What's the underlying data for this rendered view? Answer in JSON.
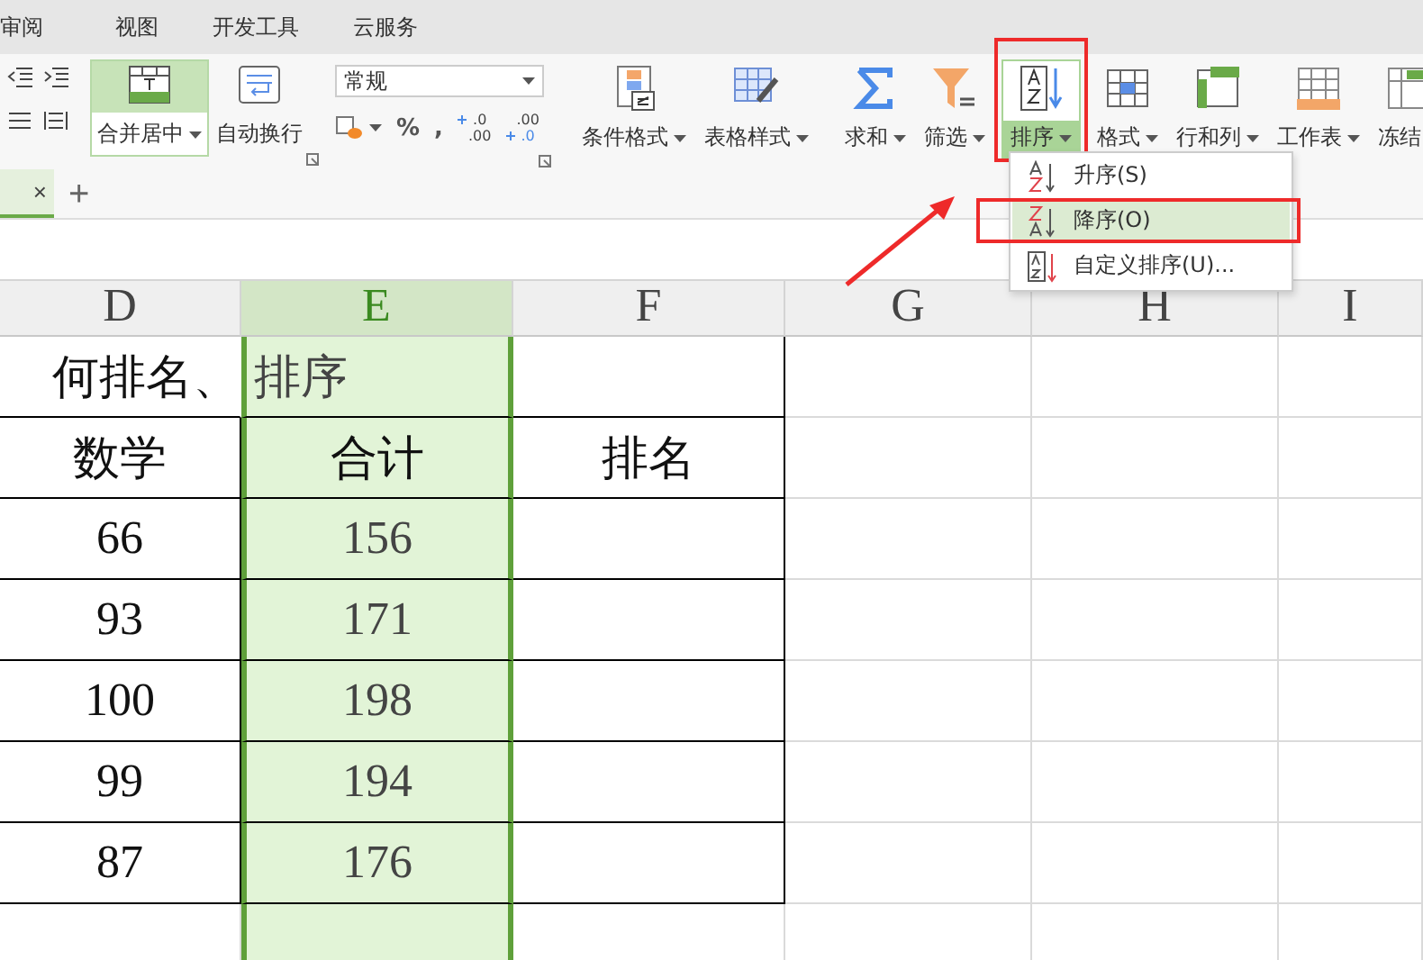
{
  "menu_tabs": [
    {
      "label": "审阅"
    },
    {
      "label": "视图"
    },
    {
      "label": "开发工具"
    },
    {
      "label": "云服务"
    }
  ],
  "merge_button": {
    "label": "合并居中",
    "selected": true
  },
  "wrap_button": {
    "label": "自动换行"
  },
  "number_format": {
    "value": "常规"
  },
  "number_buttons": [
    {
      "kind": "currency"
    },
    {
      "kind": "text",
      "label": "%"
    },
    {
      "kind": "text",
      "label": ","
    },
    {
      "kind": "decimal",
      "top": ".0",
      "bottom": ".00",
      "increase": true
    },
    {
      "kind": "decimal",
      "top": ".00",
      "bottom": ".0",
      "increase": false
    }
  ],
  "tools": [
    {
      "kind": "conditional",
      "label": "条件格式",
      "selected": false
    },
    {
      "kind": "table-style",
      "label": "表格样式",
      "selected": false
    },
    {
      "kind": "sum",
      "label": "求和",
      "selected": false
    },
    {
      "kind": "filter",
      "label": "筛选",
      "selected": false
    },
    {
      "kind": "sort",
      "label": "排序",
      "selected": true
    },
    {
      "kind": "format",
      "label": "格式",
      "selected": false
    },
    {
      "kind": "rowcol",
      "label": "行和列",
      "selected": false
    },
    {
      "kind": "sheet",
      "label": "工作表",
      "selected": false
    },
    {
      "kind": "freeze",
      "label": "冻结",
      "selected": false
    }
  ],
  "sort_menu": {
    "items": [
      {
        "kind": "asc",
        "label": "升序(S)",
        "selected": false
      },
      {
        "kind": "desc",
        "label": "降序(O)",
        "selected": true
      },
      {
        "kind": "custom",
        "label": "自定义排序(U)...",
        "selected": false
      }
    ]
  },
  "sheet_tabs": {
    "close": "×",
    "add": "+"
  },
  "columns": [
    {
      "label": "D",
      "selected": false
    },
    {
      "label": "E",
      "selected": true
    },
    {
      "label": "F",
      "selected": false
    },
    {
      "label": "G",
      "selected": false
    },
    {
      "label": "H",
      "selected": false
    },
    {
      "label": "I",
      "selected": false
    }
  ],
  "rows": [
    {
      "kind": "title",
      "cells": [
        "何排名、",
        "排序",
        ""
      ]
    },
    {
      "kind": "header",
      "cells": [
        "数学",
        "合计",
        "排名"
      ]
    },
    {
      "kind": "data",
      "cells": [
        "66",
        "156",
        ""
      ]
    },
    {
      "kind": "data",
      "cells": [
        "93",
        "171",
        ""
      ]
    },
    {
      "kind": "data",
      "cells": [
        "100",
        "198",
        ""
      ]
    },
    {
      "kind": "data",
      "cells": [
        "99",
        "194",
        ""
      ]
    },
    {
      "kind": "data",
      "cells": [
        "87",
        "176",
        ""
      ]
    },
    {
      "kind": "blank",
      "cells": [
        "",
        "",
        ""
      ]
    }
  ]
}
